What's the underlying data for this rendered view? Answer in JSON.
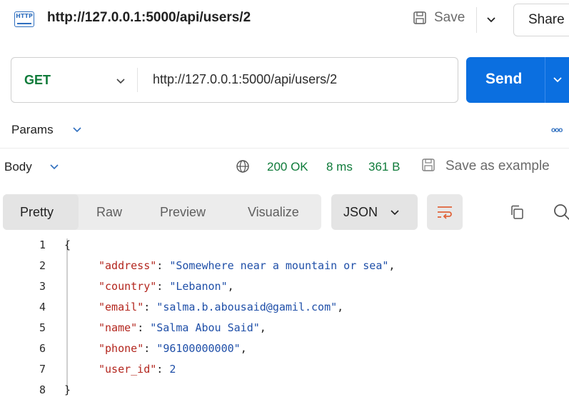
{
  "header": {
    "badge_text": "HTTP",
    "title": "http://127.0.0.1:5000/api/users/2",
    "save_label": "Save",
    "share_label": "Share"
  },
  "request": {
    "method": "GET",
    "url": "http://127.0.0.1:5000/api/users/2",
    "send_label": "Send"
  },
  "params": {
    "label": "Params",
    "more": "ooo"
  },
  "response": {
    "body_label": "Body",
    "status": "200 OK",
    "time": "8 ms",
    "size": "361 B",
    "save_example_label": "Save as example"
  },
  "view": {
    "tabs": [
      {
        "label": "Pretty",
        "active": true
      },
      {
        "label": "Raw",
        "active": false
      },
      {
        "label": "Preview",
        "active": false
      },
      {
        "label": "Visualize",
        "active": false
      }
    ],
    "format": "JSON"
  },
  "code": {
    "open_brace": "{",
    "close_brace": "}",
    "lines": [
      {
        "num": "1"
      },
      {
        "num": "2",
        "key": "address",
        "value": "Somewhere near a mountain or sea",
        "type": "string",
        "comma": true
      },
      {
        "num": "3",
        "key": "country",
        "value": "Lebanon",
        "type": "string",
        "comma": true
      },
      {
        "num": "4",
        "key": "email",
        "value": "salma.b.abousaid@gamil.com",
        "type": "string",
        "comma": true
      },
      {
        "num": "5",
        "key": "name",
        "value": "Salma Abou Said",
        "type": "string",
        "comma": true
      },
      {
        "num": "6",
        "key": "phone",
        "value": "96100000000",
        "type": "string",
        "comma": true
      },
      {
        "num": "7",
        "key": "user_id",
        "value": "2",
        "type": "number",
        "comma": false
      },
      {
        "num": "8"
      }
    ]
  },
  "icons": {
    "save": "floppy-disk-icon",
    "globe": "globe-icon",
    "save_example": "floppy-disk-icon",
    "wrap": "text-wrap-icon",
    "copy": "copy-icon",
    "search": "search-icon"
  },
  "colors": {
    "send_button": "#0b6fe0",
    "method_get": "#0f7b3a",
    "status_ok": "#0f7b3a",
    "json_key": "#b3261e",
    "json_value": "#1f4fa8",
    "wrap_icon": "#e0643a"
  }
}
